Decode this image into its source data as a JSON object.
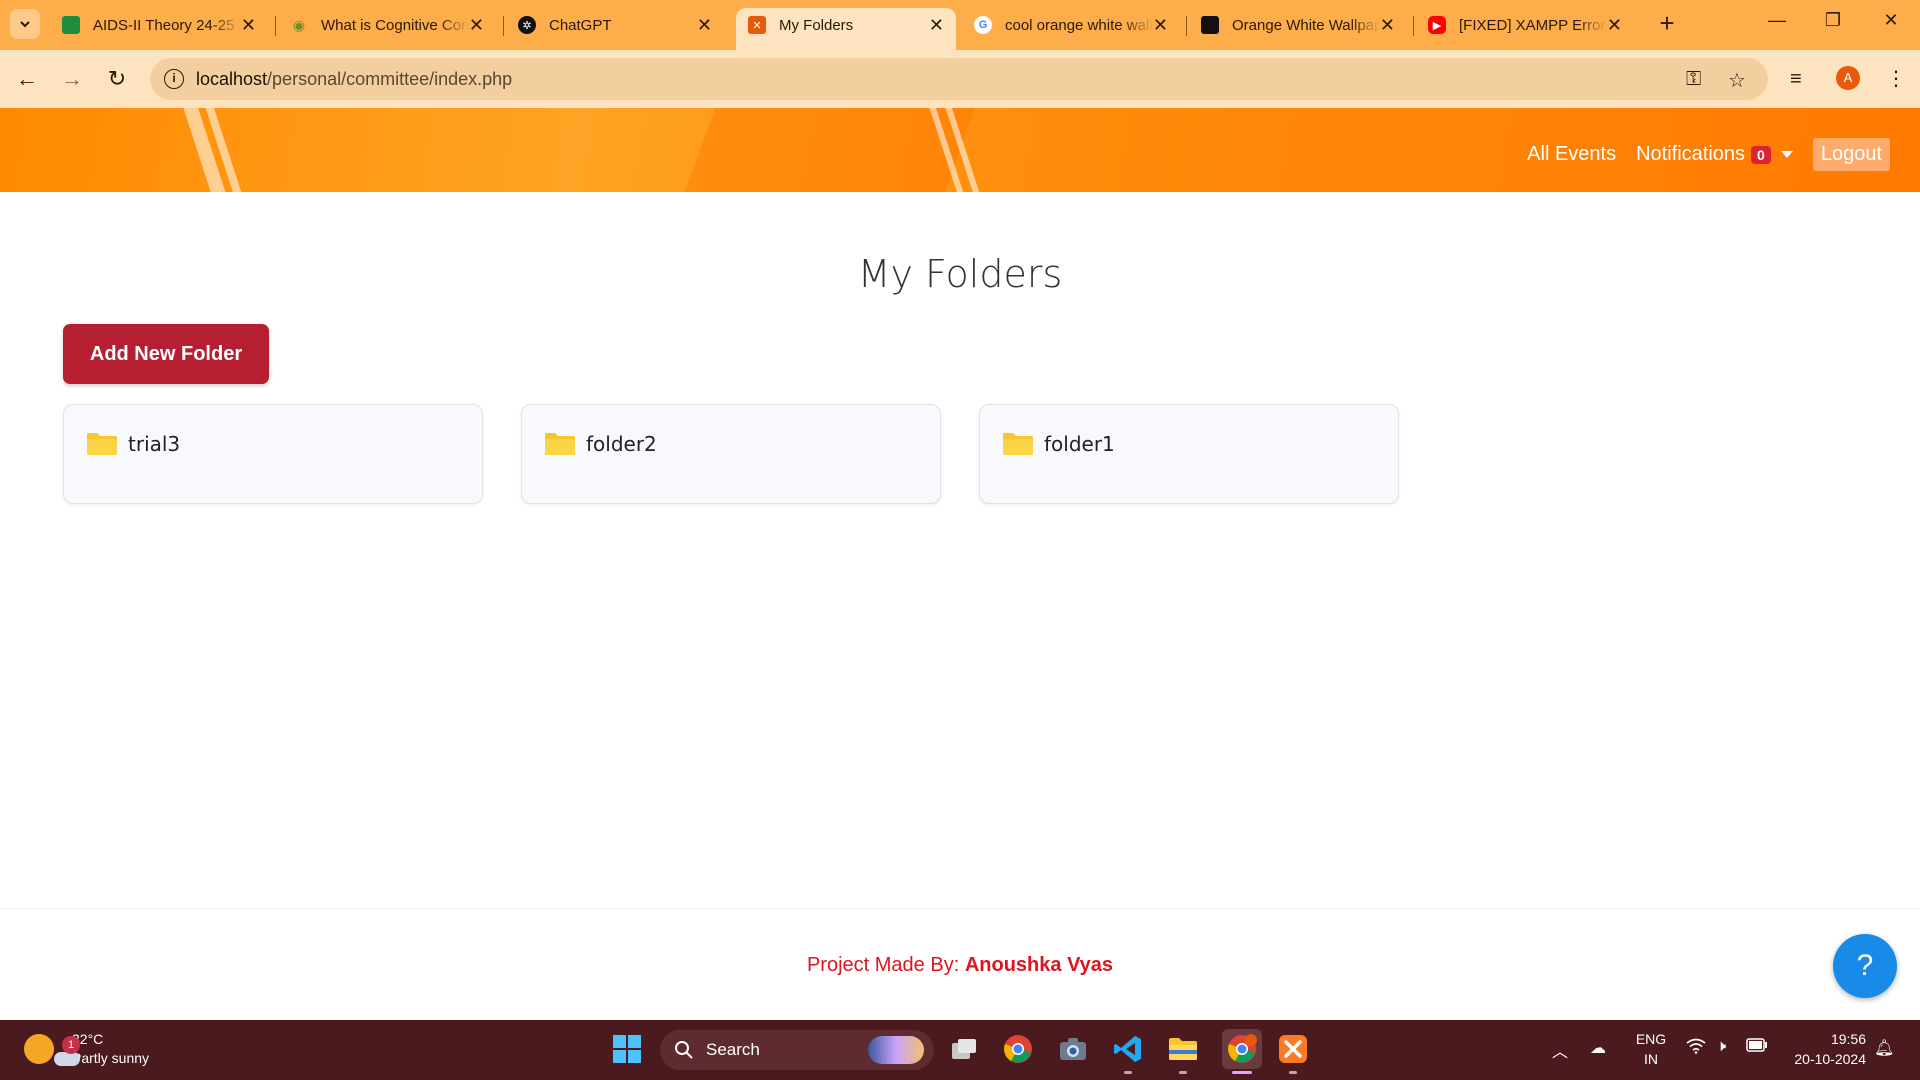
{
  "browser": {
    "tabs": [
      {
        "title": "AIDS-II Theory 24-25",
        "favicon_color": "#1e8e3e"
      },
      {
        "title": "What is Cognitive Computing",
        "favicon_color": "#6b8e23"
      },
      {
        "title": "ChatGPT",
        "favicon_color": "#111111"
      },
      {
        "title": "My Folders",
        "favicon_color": "#e8590c"
      },
      {
        "title": "cool orange white wallpaper",
        "favicon_color": "#4285f4"
      },
      {
        "title": "Orange White Wallpapers",
        "favicon_color": "#111111"
      },
      {
        "title": "[FIXED] XAMPP Error",
        "favicon_color": "#ff0000"
      }
    ],
    "url_host": "localhost",
    "url_path": "/personal/committee/index.php",
    "profile_initial": "A"
  },
  "header": {
    "nav_all_events": "All Events",
    "nav_notifications": "Notifications",
    "notification_count": "0",
    "nav_logout": "Logout"
  },
  "main": {
    "page_title": "My Folders",
    "add_button_label": "Add New Folder",
    "folders": [
      {
        "name": "trial3"
      },
      {
        "name": "folder2"
      },
      {
        "name": "folder1"
      }
    ]
  },
  "footer": {
    "made_by_label": "Project Made By:",
    "author": "Anoushka Vyas",
    "help_label": "?"
  },
  "taskbar": {
    "weather_badge": "1",
    "temperature": "32°C",
    "condition": "Partly sunny",
    "search_label": "Search",
    "lang_line1": "ENG",
    "lang_line2": "IN",
    "time": "19:56",
    "date": "20-10-2024"
  },
  "colors": {
    "header_orange": "#ff8a00",
    "add_button": "#b61e32",
    "footer_text": "#e0141e",
    "help_button": "#1a8ae8",
    "folder_icon": "#f7c52c",
    "taskbar": "#4a1a1f"
  }
}
